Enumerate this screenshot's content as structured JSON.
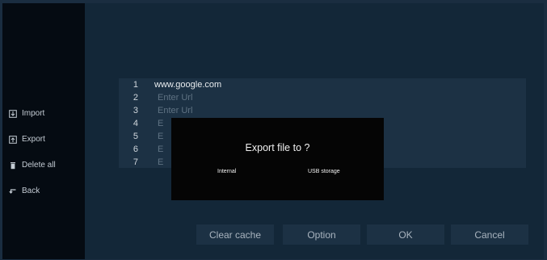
{
  "sidebar": {
    "items": [
      {
        "label": "Import",
        "icon": "import-icon"
      },
      {
        "label": "Export",
        "icon": "export-icon"
      },
      {
        "label": "Delete all",
        "icon": "trash-icon"
      },
      {
        "label": "Back",
        "icon": "back-arrow-icon"
      }
    ]
  },
  "url_list": {
    "rows": [
      {
        "number": "1",
        "value": "www.google.com"
      },
      {
        "number": "2",
        "value": "Enter Url"
      },
      {
        "number": "3",
        "value": "Enter Url"
      },
      {
        "number": "4",
        "value": "E"
      },
      {
        "number": "5",
        "value": "E"
      },
      {
        "number": "6",
        "value": "E"
      },
      {
        "number": "7",
        "value": "E"
      }
    ]
  },
  "buttons": {
    "clear_cache": "Clear cache",
    "option": "Option",
    "ok": "OK",
    "cancel": "Cancel"
  },
  "dialog": {
    "title": "Export file to ?",
    "option_internal": "Internal",
    "option_usb": "USB storage"
  },
  "colors": {
    "background": "#14283a",
    "sidebar": "#050b12",
    "panel": "#1c3144",
    "dialog": "#050505"
  }
}
